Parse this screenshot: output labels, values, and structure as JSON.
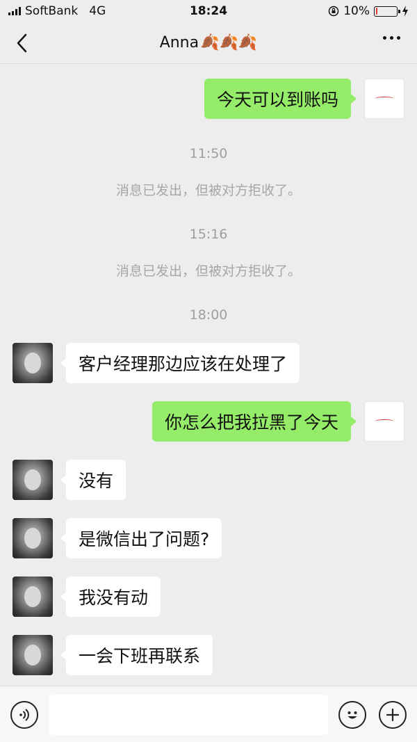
{
  "status_bar": {
    "carrier": "SoftBank",
    "network": "4G",
    "time": "18:24",
    "battery": "10%",
    "battery_level": 0.1
  },
  "nav": {
    "title": "Anna",
    "title_emoji": "🍂🍂🍂"
  },
  "messages": [
    {
      "from": "self",
      "text": "今天可以到账吗"
    },
    {
      "type": "time",
      "text": "11:50"
    },
    {
      "type": "system",
      "text": "消息已发出，但被对方拒收了。"
    },
    {
      "type": "time",
      "text": "15:16"
    },
    {
      "type": "system",
      "text": "消息已发出，但被对方拒收了。"
    },
    {
      "type": "time",
      "text": "18:00"
    },
    {
      "from": "other",
      "text": "客户经理那边应该在处理了"
    },
    {
      "from": "self",
      "text": "你怎么把我拉黑了今天"
    },
    {
      "from": "other",
      "text": "没有"
    },
    {
      "from": "other",
      "text": "是微信出了问题?"
    },
    {
      "from": "other",
      "text": "我没有动"
    },
    {
      "from": "other",
      "text": "一会下班再联系"
    }
  ],
  "input": {
    "value": "",
    "placeholder": ""
  },
  "colors": {
    "self_bubble": "#95ec69",
    "other_bubble": "#ffffff",
    "background": "#ededed",
    "battery_low": "#e53935"
  },
  "icons": {
    "back": "chevron-left-icon",
    "more": "more-dots-icon",
    "voice": "voice-icon",
    "emoji": "emoji-icon",
    "plus": "plus-icon"
  }
}
